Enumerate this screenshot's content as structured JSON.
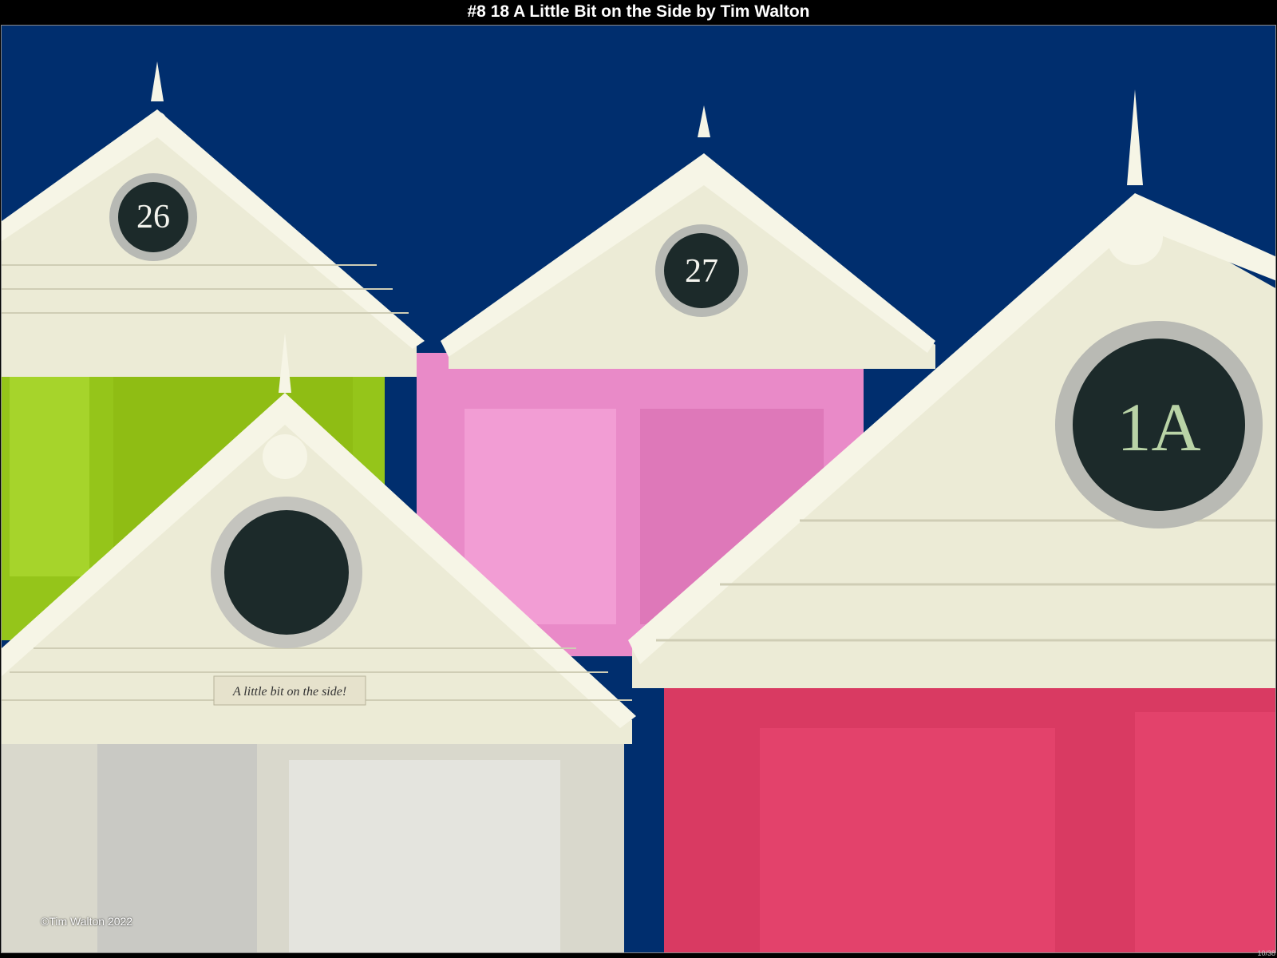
{
  "header": {
    "title": "#8 18 A Little Bit on the Side by Tim Walton"
  },
  "photo": {
    "hut_numbers": [
      "26",
      "27",
      "1A"
    ],
    "sign_text": "A little bit on the side!",
    "copyright": "©Tim Walton 2022",
    "counter": "10/38"
  },
  "colors": {
    "sky": "#002e6e",
    "trim": "#ecebd6",
    "lime": "#95c51a",
    "pink": "#e98ac8",
    "red": "#d93a62",
    "plate": "#1c2a2a"
  }
}
